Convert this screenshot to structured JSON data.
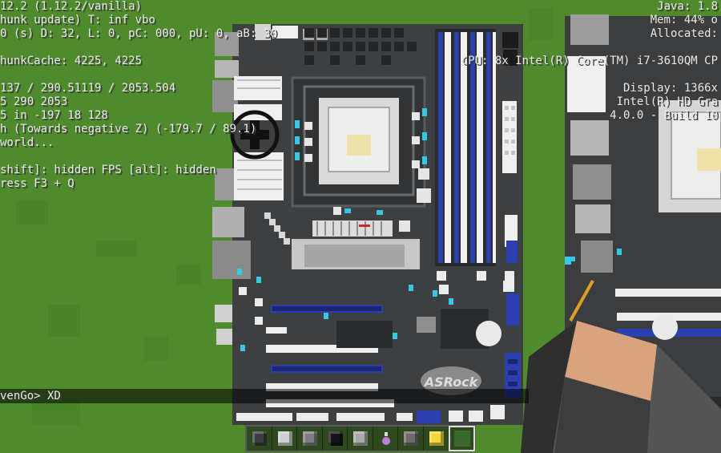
{
  "debug_left": [
    "12.2 (1.12.2/vanilla)",
    "hunk update) T: inf vbo",
    "0 (s) D: 32, L: 0, pC: 000, pU: 0, aB: 30",
    "",
    "hunkCache: 4225, 4225",
    "",
    "137 / 290.51119 / 2053.504",
    "5 290 2053",
    "5 in -197 18 128",
    "h (Towards negative Z) (-179.7 / 89.1)",
    "world...",
    "",
    "shift]: hidden FPS [alt]: hidden",
    "ress F3 + Q"
  ],
  "debug_right": [
    "Java: 1.8",
    "Mem: 44% o",
    "Allocated:",
    "",
    "CPU: 8x Intel(R) Core(TM) i7-3610QM CP",
    "",
    "Display: 1366x",
    "Intel(R) HD Gra",
    "4.0.0 - Build 10"
  ],
  "chat_message": "venGo> XD",
  "board_logo": "ASRock",
  "hotbar": {
    "selected_index": 8,
    "slots": [
      {
        "icon": "dark-stone-block-icon",
        "color": "#3c3c3c"
      },
      {
        "icon": "iron-block-icon",
        "color": "#cfcfcf"
      },
      {
        "icon": "stone-block-icon",
        "color": "#7d7d7d"
      },
      {
        "icon": "black-wool-block-icon",
        "color": "#151515"
      },
      {
        "icon": "light-gray-block-icon",
        "color": "#a8a8a8"
      },
      {
        "icon": "potion-icon",
        "color": "#c07ad8"
      },
      {
        "icon": "cobblestone-block-icon",
        "color": "#6b6b6b"
      },
      {
        "icon": "gold-block-icon",
        "color": "#f5d63a"
      },
      {
        "icon": "empty-slot-icon",
        "color": ""
      }
    ]
  },
  "colors": {
    "grass": "#4f8a2c",
    "pcb": "#3d3f41",
    "pcb_dark": "#2a2b2d",
    "accent_blue": "#2b3fb0",
    "white": "#ececec",
    "light_gray": "#b9b9b9",
    "cyan": "#36c8e6",
    "skin": "#d8a37d"
  }
}
